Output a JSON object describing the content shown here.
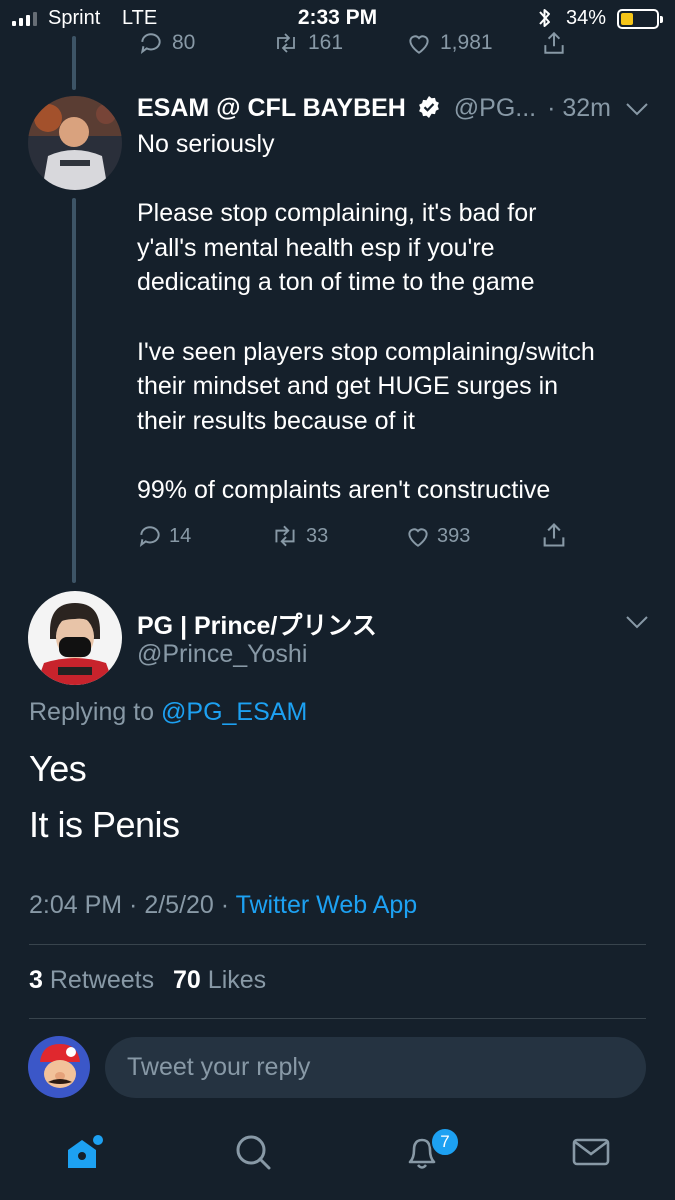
{
  "status_bar": {
    "carrier": "Sprint",
    "network": "LTE",
    "time": "2:33 PM",
    "battery_percent": "34%",
    "battery_level": 0.34
  },
  "previous_tweet_actions": {
    "replies": "80",
    "retweets": "161",
    "likes": "1,981"
  },
  "parent_tweet": {
    "display_name": "ESAM @ CFL BAYBEH",
    "verified": true,
    "handle": "@PG...",
    "age": "· 32m",
    "text": "No seriously\n\nPlease stop complaining, it's bad for\ny'all's mental health esp if you're\ndedicating a ton of time to the game\n\nI've seen players stop complaining/switch\ntheir mindset and get HUGE surges in\ntheir results because of it\n\n99% of complaints aren't constructive",
    "replies": "14",
    "retweets": "33",
    "likes": "393"
  },
  "main_tweet": {
    "display_name": "PG | Prince/プリンス",
    "handle": "@Prince_Yoshi",
    "replying_prefix": "Replying to",
    "replying_to": "@PG_ESAM",
    "text_line1": "Yes",
    "text_line2": "It is Penis",
    "timestamp": "2:04 PM · 2/5/20 ·",
    "source": "Twitter Web App",
    "retweet_count": "3",
    "retweets_label": "Retweets",
    "like_count": "70",
    "likes_label": "Likes"
  },
  "reply_bar": {
    "placeholder": "Tweet your reply"
  },
  "tab_bar": {
    "notifications_badge": "7"
  },
  "colors": {
    "background": "#15202b",
    "accent": "#1da1f2",
    "muted": "#8899a6",
    "battery": "#f5c518"
  }
}
